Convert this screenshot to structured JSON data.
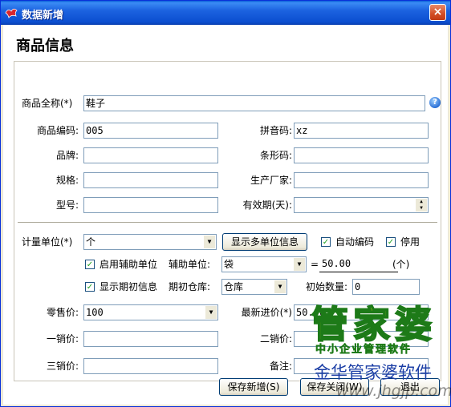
{
  "window": {
    "title": "数据新增",
    "close": "×"
  },
  "header": {
    "title": "商品信息"
  },
  "form": {
    "full_name_label": "商品全称(*)",
    "full_name_value": "鞋子",
    "help": "?",
    "code_label": "商品编码:",
    "code_value": "005",
    "pinyin_label": "拼音码:",
    "pinyin_value": "xz",
    "brand_label": "品牌:",
    "brand_value": "",
    "barcode_label": "条形码:",
    "barcode_value": "",
    "spec_label": "规格:",
    "spec_value": "",
    "maker_label": "生产厂家:",
    "maker_value": "",
    "model_label": "型号:",
    "model_value": "",
    "expiry_label": "有效期(天):",
    "expiry_value": ""
  },
  "units": {
    "unit_label": "计量单位(*)",
    "unit_value": "个",
    "multi_unit_button": "显示多单位信息",
    "auto_code_label": "自动编码",
    "auto_code_checked": true,
    "disable_label": "停用",
    "disable_checked": true,
    "aux_enable_label": "启用辅助单位",
    "aux_enable_checked": true,
    "aux_unit_label": "辅助单位:",
    "aux_unit_value": "袋",
    "equals": "=",
    "ratio_value": "50.00",
    "ratio_unit": "(个)",
    "show_initial_label": "显示期初信息",
    "show_initial_checked": true,
    "initial_store_label": "期初仓库:",
    "initial_store_value": "仓库",
    "initial_qty_label": "初始数量:",
    "initial_qty_value": "0"
  },
  "prices": {
    "retail_label": "零售价:",
    "retail_value": "100",
    "latest_buy_label": "最新进价(*)",
    "latest_buy_value": "50.00",
    "price1_label": "一销价:",
    "price1_value": "",
    "price2_label": "二销价:",
    "price2_value": "",
    "price3_label": "三销价:",
    "price3_value": "",
    "note_label": "备注:",
    "note_value": ""
  },
  "buttons": {
    "save_new": "保存新增(S)",
    "save_close": "保存关闭(W)",
    "exit": "退出"
  },
  "watermark": {
    "brand": "管家婆",
    "slogan": "中小企业管理软件",
    "company": "金华管家婆软件",
    "url": "www.jhgjp.com"
  },
  "colors": {
    "titlebar": "#0b4ed0",
    "dialog_bg": "#ece9d8",
    "input_border": "#7f9db9",
    "check_mark": "#21a121"
  }
}
